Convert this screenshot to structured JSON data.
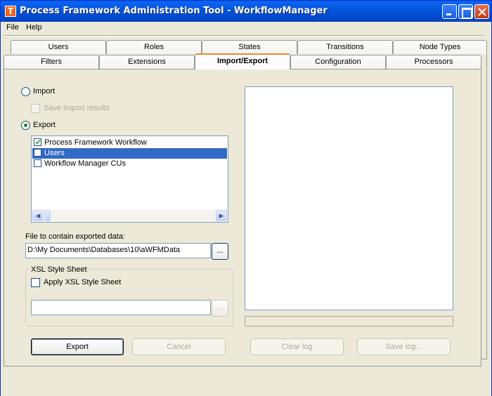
{
  "window": {
    "title": "Process Framework Administration Tool - WorkflowManager",
    "app_icon_letter": "T"
  },
  "menu": [
    "File",
    "Help"
  ],
  "tabs_back": [
    "Users",
    "Roles",
    "States",
    "Transitions",
    "Node Types"
  ],
  "tabs_front": [
    "Filters",
    "Extensions",
    "Import/Export",
    "Configuration",
    "Processors"
  ],
  "import_export": {
    "import_label": "Import",
    "save_results_label": "Save import results",
    "export_label": "Export",
    "export_items": [
      {
        "label": "Process Framework Workflow",
        "checked": true,
        "selected": false
      },
      {
        "label": "Users",
        "checked": false,
        "selected": true
      },
      {
        "label": "Workflow Manager CUs",
        "checked": false,
        "selected": false
      }
    ],
    "file_label": "File to contain exported data:",
    "file_value": "D:\\My Documents\\Databases\\10\\aWFMData",
    "browse_label": "...",
    "xsl_group_title": "XSL Style Sheet",
    "apply_xsl_label": "Apply XSL Style Sheet",
    "xsl_value": "",
    "xsl_browse_label": "..."
  },
  "buttons": {
    "export": "Export",
    "cancel": "Cancel",
    "clear_log": "Clear log",
    "save_log": "Save log..."
  }
}
